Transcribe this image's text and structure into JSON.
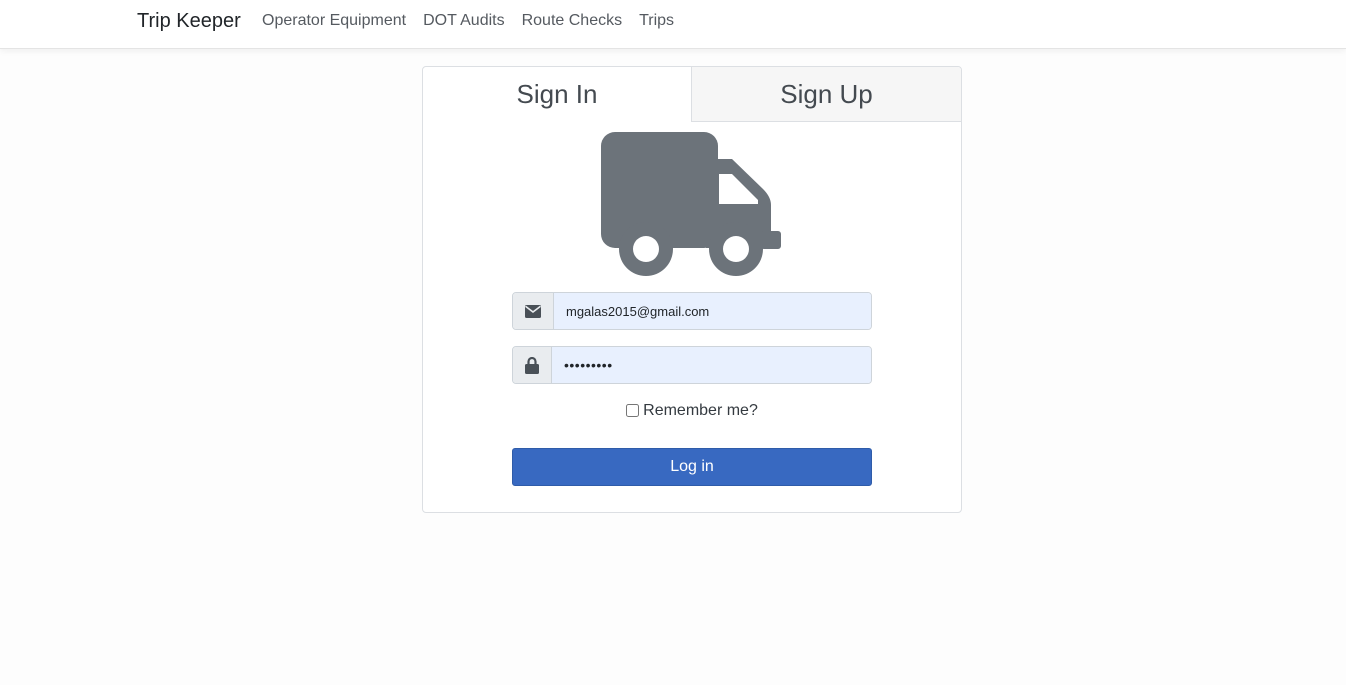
{
  "navbar": {
    "brand": "Trip Keeper",
    "links": [
      "Operator Equipment",
      "DOT Audits",
      "Route Checks",
      "Trips"
    ]
  },
  "tabs": {
    "sign_in": "Sign In",
    "sign_up": "Sign Up"
  },
  "form": {
    "email_value": "mgalas2015@gmail.com",
    "password_value": "•••••••••",
    "remember_label": "Remember me?",
    "login_label": "Log in"
  },
  "icons": {
    "logo": "truck-icon",
    "email": "envelope-icon",
    "password": "lock-icon"
  },
  "colors": {
    "accent": "#3869c1",
    "icon_gray": "#6c737a",
    "autofill_bg": "#e8f0fe"
  }
}
